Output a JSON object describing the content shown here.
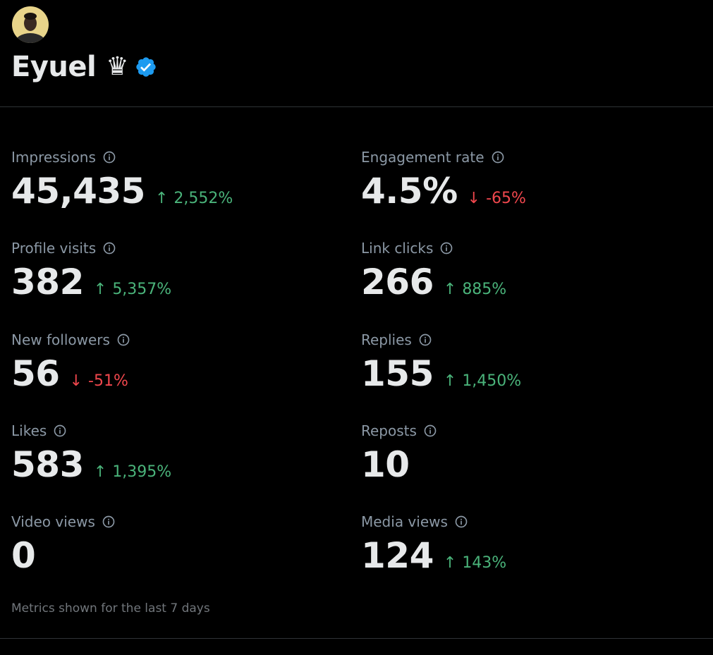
{
  "profile": {
    "name": "Eyuel",
    "badge_emoji": "♛",
    "verified": true,
    "avatar": "user-avatar"
  },
  "colors": {
    "background": "#000000",
    "text_primary": "#e7e9ea",
    "text_secondary": "#8b98a5",
    "positive": "#4ab37a",
    "negative": "#f0474d",
    "verified_blue": "#1d9bf0",
    "divider": "#2f3336"
  },
  "metrics": {
    "impressions": {
      "label": "Impressions",
      "value": "45,435",
      "change": "2,552%",
      "direction": "up",
      "arrow": "↑",
      "icon": "info-icon"
    },
    "engagement_rate": {
      "label": "Engagement rate",
      "value": "4.5%",
      "change": "-65%",
      "direction": "down",
      "arrow": "↓",
      "icon": "info-icon"
    },
    "profile_visits": {
      "label": "Profile visits",
      "value": "382",
      "change": "5,357%",
      "direction": "up",
      "arrow": "↑",
      "icon": "info-icon"
    },
    "link_clicks": {
      "label": "Link clicks",
      "value": "266",
      "change": "885%",
      "direction": "up",
      "arrow": "↑",
      "icon": "info-icon"
    },
    "new_followers": {
      "label": "New followers",
      "value": "56",
      "change": "-51%",
      "direction": "down",
      "arrow": "↓",
      "icon": "info-icon"
    },
    "replies": {
      "label": "Replies",
      "value": "155",
      "change": "1,450%",
      "direction": "up",
      "arrow": "↑",
      "icon": "info-icon"
    },
    "likes": {
      "label": "Likes",
      "value": "583",
      "change": "1,395%",
      "direction": "up",
      "arrow": "↑",
      "icon": "info-icon"
    },
    "reposts": {
      "label": "Reposts",
      "value": "10",
      "icon": "info-icon"
    },
    "video_views": {
      "label": "Video views",
      "value": "0",
      "icon": "info-icon"
    },
    "media_views": {
      "label": "Media views",
      "value": "124",
      "change": "143%",
      "direction": "up",
      "arrow": "↑",
      "icon": "info-icon"
    }
  },
  "footer": {
    "note": "Metrics shown for the last 7 days"
  }
}
